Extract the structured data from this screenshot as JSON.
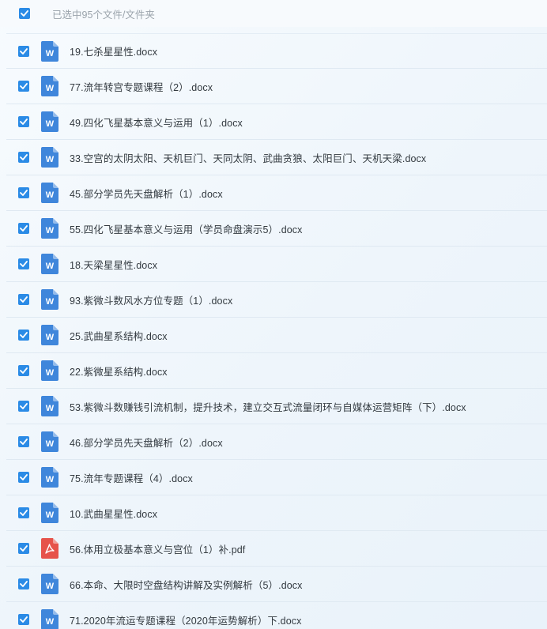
{
  "header": {
    "selection_label": "已选中95个文件/文件夹",
    "checked": true
  },
  "colors": {
    "accent": "#2b8be6",
    "word_icon": "#3f86db",
    "pdf_icon": "#e6534a",
    "text": "#333a40",
    "muted": "#9aa3ab"
  },
  "files": [
    {
      "name": "19.七杀星星性.docx",
      "type": "docx",
      "icon": "word-icon",
      "checked": true
    },
    {
      "name": "77.流年转宫专题课程（2）.docx",
      "type": "docx",
      "icon": "word-icon",
      "checked": true
    },
    {
      "name": "49.四化飞星基本意义与运用（1）.docx",
      "type": "docx",
      "icon": "word-icon",
      "checked": true
    },
    {
      "name": "33.空宫的太阴太阳、天机巨门、天同太阴、武曲贪狼、太阳巨门、天机天梁.docx",
      "type": "docx",
      "icon": "word-icon",
      "checked": true
    },
    {
      "name": "45.部分学员先天盘解析（1）.docx",
      "type": "docx",
      "icon": "word-icon",
      "checked": true
    },
    {
      "name": "55.四化飞星基本意义与运用（学员命盘演示5）.docx",
      "type": "docx",
      "icon": "word-icon",
      "checked": true
    },
    {
      "name": "18.天梁星星性.docx",
      "type": "docx",
      "icon": "word-icon",
      "checked": true
    },
    {
      "name": "93.紫微斗数风水方位专题（1）.docx",
      "type": "docx",
      "icon": "word-icon",
      "checked": true
    },
    {
      "name": "25.武曲星系结构.docx",
      "type": "docx",
      "icon": "word-icon",
      "checked": true
    },
    {
      "name": "22.紫微星系结构.docx",
      "type": "docx",
      "icon": "word-icon",
      "checked": true
    },
    {
      "name": "53.紫微斗数赚钱引流机制，提升技术，建立交互式流量闭环与自媒体运营矩阵（下）.docx",
      "type": "docx",
      "icon": "word-icon",
      "checked": true
    },
    {
      "name": "46.部分学员先天盘解析（2）.docx",
      "type": "docx",
      "icon": "word-icon",
      "checked": true
    },
    {
      "name": "75.流年专题课程（4）.docx",
      "type": "docx",
      "icon": "word-icon",
      "checked": true
    },
    {
      "name": "10.武曲星星性.docx",
      "type": "docx",
      "icon": "word-icon",
      "checked": true
    },
    {
      "name": "56.体用立极基本意义与宫位（1）补.pdf",
      "type": "pdf",
      "icon": "pdf-icon",
      "checked": true
    },
    {
      "name": "66.本命、大限时空盘结构讲解及实例解析（5）.docx",
      "type": "docx",
      "icon": "word-icon",
      "checked": true
    },
    {
      "name": "71.2020年流运专题课程（2020年运势解析）下.docx",
      "type": "docx",
      "icon": "word-icon",
      "checked": true
    }
  ]
}
